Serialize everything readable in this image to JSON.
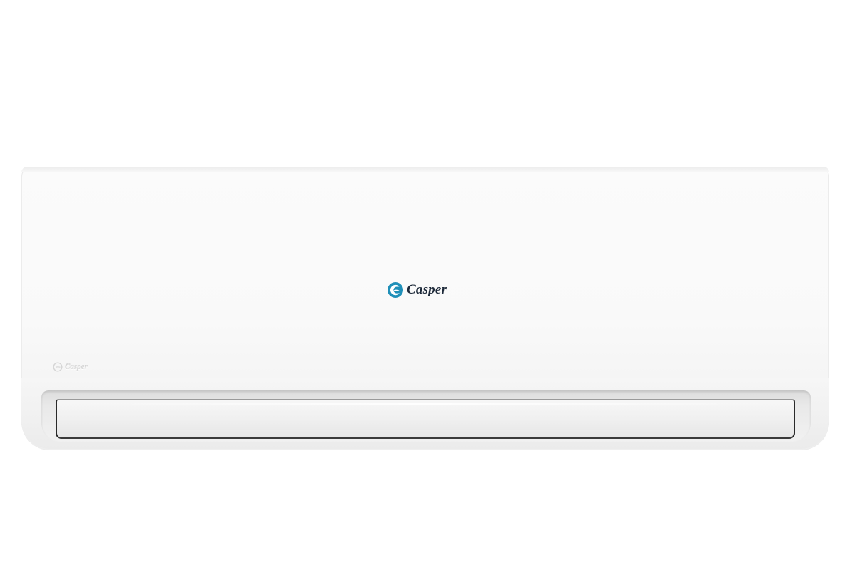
{
  "product": {
    "brand_text": "Casper",
    "emboss_text": "Casper",
    "colors": {
      "body": "#f9f9f9",
      "logo_mark": "#1f8fb8",
      "logo_text": "#1e2a3a",
      "louver_edge": "#2a2a2a"
    },
    "icons": [
      "casper-logo-icon",
      "casper-emboss-icon"
    ]
  }
}
